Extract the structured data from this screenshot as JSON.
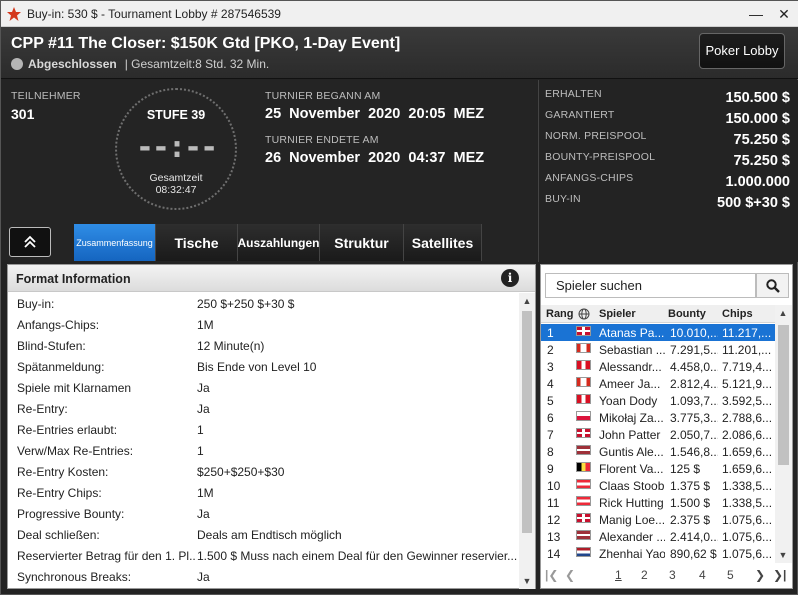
{
  "window": {
    "title": "Buy-in: 530 $ - Tournament Lobby # 287546539"
  },
  "header": {
    "tournament_name": "CPP #11 The Closer: $150K Gtd [PKO, 1-Day Event]",
    "status": "Abgeschlossen",
    "total_time": "| Gesamtzeit:8 Std.  32 Min.",
    "lobby_button": "Poker Lobby"
  },
  "info": {
    "players_label": "TEILNEHMER",
    "players_value": "301",
    "level": "STUFE 39",
    "clock": "--:--",
    "total_label": "Gesamtzeit",
    "total_value": "08:32:47",
    "started_label": "TURNIER BEGANN AM",
    "started_value": "25 November 2020  20:05 MEZ",
    "ended_label": "TURNIER ENDETE AM",
    "ended_value": "26 November 2020  04:37 MEZ"
  },
  "tabs": [
    {
      "label": "Zusammenfassung"
    },
    {
      "label": "Tische"
    },
    {
      "label": "Auszahlungen"
    },
    {
      "label": "Struktur"
    },
    {
      "label": "Satellites"
    }
  ],
  "prizes": [
    {
      "label": "ERHALTEN",
      "value": "150.500 $"
    },
    {
      "label": "GARANTIERT",
      "value": "150.000 $"
    },
    {
      "label": "NORM. PREISPOOL",
      "value": "75.250 $"
    },
    {
      "label": "BOUNTY-PREISPOOL",
      "value": "75.250 $"
    },
    {
      "label": "ANFANGS-CHIPS",
      "value": "1.000.000"
    },
    {
      "label": "BUY-IN",
      "value": "500 $+30 $"
    }
  ],
  "format": {
    "title": "Format Information",
    "rows": [
      {
        "k": "Buy-in:",
        "v": "250 $+250 $+30 $"
      },
      {
        "k": "Anfangs-Chips:",
        "v": "1M"
      },
      {
        "k": "Blind-Stufen:",
        "v": "12 Minute(n)"
      },
      {
        "k": "Spätanmeldung:",
        "v": "Bis Ende von Level 10"
      },
      {
        "k": "Spiele mit Klarnamen",
        "v": "Ja"
      },
      {
        "k": "Re-Entry:",
        "v": "Ja"
      },
      {
        "k": "Re-Entries erlaubt:",
        "v": "1"
      },
      {
        "k": "Verw/Max Re-Entries:",
        "v": "1"
      },
      {
        "k": "Re-Entry Kosten:",
        "v": "$250+$250+$30"
      },
      {
        "k": "Re-Entry Chips:",
        "v": "1M"
      },
      {
        "k": "Progressive Bounty:",
        "v": "Ja"
      },
      {
        "k": "Deal schließen:",
        "v": "Deals am Endtisch möglich"
      },
      {
        "k": "Reservierter Betrag für den 1. Pl...",
        "v": "1.500 $ Muss nach einem Deal für den Gewinner reservier..."
      },
      {
        "k": "Synchronous Breaks:",
        "v": "Ja"
      }
    ]
  },
  "players": {
    "search_placeholder": "Spieler suchen",
    "columns": {
      "rank": "Rang",
      "player": "Spieler",
      "bounty": "Bounty",
      "chips": "Chips"
    },
    "rows": [
      {
        "rank": "1",
        "flag": "gb",
        "name": "Atanas Pa...",
        "bounty": "10.010,...",
        "chips": "11.217,..."
      },
      {
        "rank": "2",
        "flag": "ca",
        "name": "Sebastian ...",
        "bounty": "7.291,5...",
        "chips": "11.201,..."
      },
      {
        "rank": "3",
        "flag": "pe",
        "name": "Alessandr...",
        "bounty": "4.458,0...",
        "chips": "7.719,4..."
      },
      {
        "rank": "4",
        "flag": "ca",
        "name": "Ameer Ja...",
        "bounty": "2.812,4...",
        "chips": "5.121,9..."
      },
      {
        "rank": "5",
        "flag": "pe",
        "name": "Yoan Dody",
        "bounty": "1.093,7...",
        "chips": "3.592,5..."
      },
      {
        "rank": "6",
        "flag": "pl",
        "name": "Mikołaj Za...",
        "bounty": "3.775,3...",
        "chips": "2.788,6..."
      },
      {
        "rank": "7",
        "flag": "gb",
        "name": "John Patter",
        "bounty": "2.050,7...",
        "chips": "2.086,6..."
      },
      {
        "rank": "8",
        "flag": "lv",
        "name": "Guntis Ale...",
        "bounty": "1.546,8...",
        "chips": "1.659,6..."
      },
      {
        "rank": "9",
        "flag": "be",
        "name": "Florent Va...",
        "bounty": "125 $",
        "chips": "1.659,6..."
      },
      {
        "rank": "10",
        "flag": "at",
        "name": "Claas Stoob",
        "bounty": "1.375 $",
        "chips": "1.338,5..."
      },
      {
        "rank": "11",
        "flag": "at",
        "name": "Rick Hutting",
        "bounty": "1.500 $",
        "chips": "1.338,5..."
      },
      {
        "rank": "12",
        "flag": "gb",
        "name": "Manig Loe...",
        "bounty": "2.375 $",
        "chips": "1.075,6..."
      },
      {
        "rank": "13",
        "flag": "lv",
        "name": "Alexander ...",
        "bounty": "2.414,0...",
        "chips": "1.075,6..."
      },
      {
        "rank": "14",
        "flag": "nl",
        "name": "Zhenhai Yao",
        "bounty": "890,62 $",
        "chips": "1.075,6..."
      }
    ],
    "pages": [
      "1",
      "2",
      "3",
      "4",
      "5"
    ]
  },
  "colors": {
    "accent": "#1a73d4",
    "tab_active": "#1e7ad6",
    "header_bg": "#2f2f2f"
  }
}
